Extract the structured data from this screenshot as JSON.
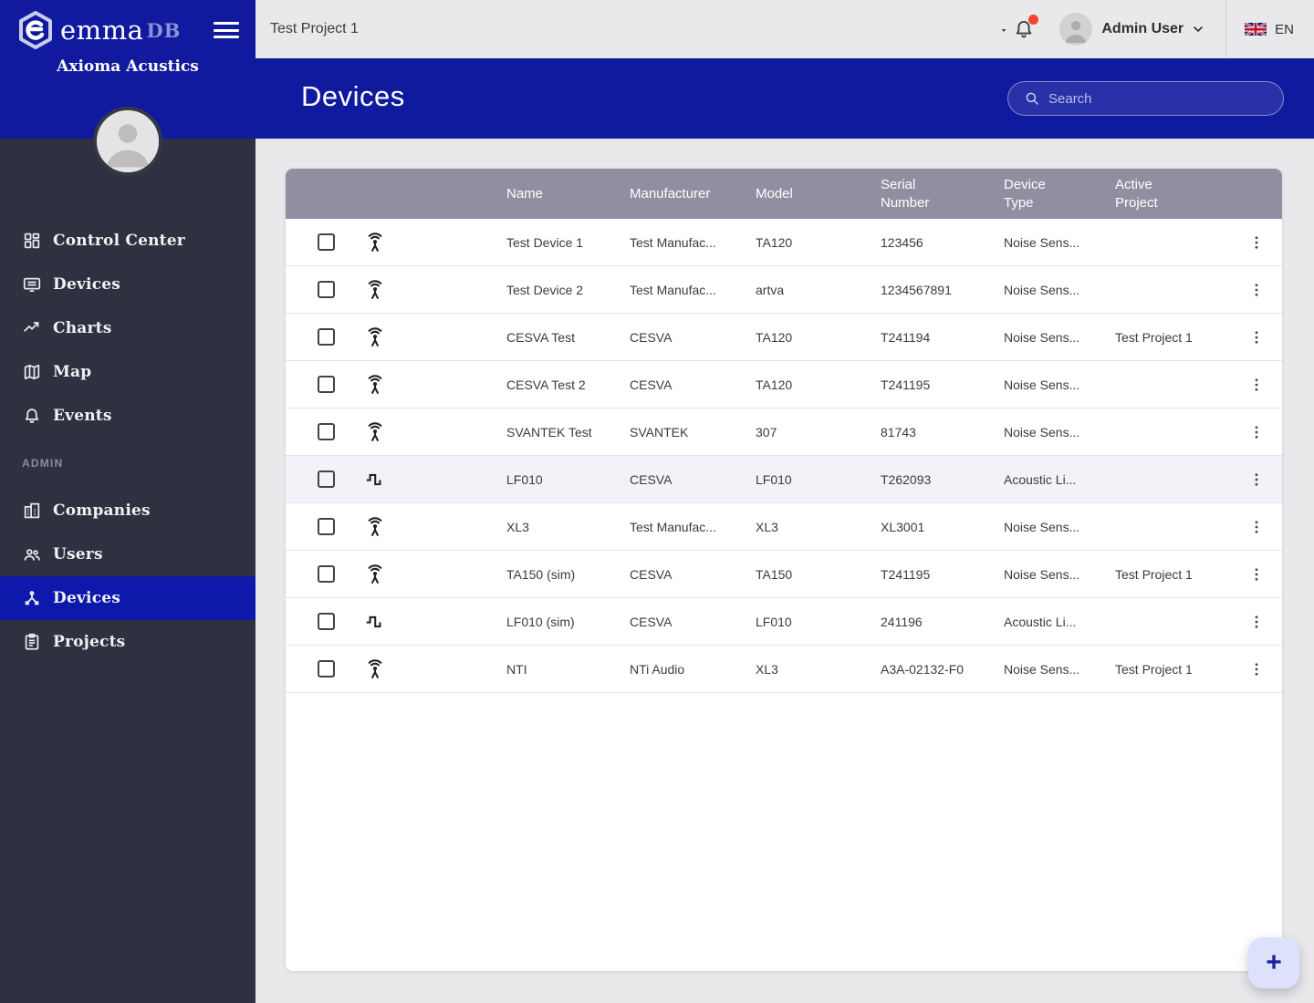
{
  "brand": {
    "logo_text": "emma",
    "logo_suffix": "DB",
    "company": "Axioma Acustics"
  },
  "topbar": {
    "project": "Test Project 1",
    "user_name": "Admin User",
    "language": "EN"
  },
  "page": {
    "title": "Devices",
    "search_placeholder": "Search"
  },
  "sidebar": {
    "admin_label": "ADMIN",
    "main_items": [
      {
        "id": "control-center",
        "label": "Control Center",
        "icon": "dashboard",
        "active": false
      },
      {
        "id": "devices",
        "label": "Devices",
        "icon": "screen",
        "active": false
      },
      {
        "id": "charts",
        "label": "Charts",
        "icon": "chart",
        "active": false
      },
      {
        "id": "map",
        "label": "Map",
        "icon": "map",
        "active": false
      },
      {
        "id": "events",
        "label": "Events",
        "icon": "bell",
        "active": false
      }
    ],
    "admin_items": [
      {
        "id": "companies",
        "label": "Companies",
        "icon": "building",
        "active": false
      },
      {
        "id": "users",
        "label": "Users",
        "icon": "users",
        "active": false
      },
      {
        "id": "admin-devices",
        "label": "Devices",
        "icon": "hub",
        "active": true
      },
      {
        "id": "projects",
        "label": "Projects",
        "icon": "clipboard",
        "active": false
      }
    ]
  },
  "table": {
    "columns": [
      "Name",
      "Manufacturer",
      "Model",
      "Serial Number",
      "Device Type",
      "Active Project"
    ],
    "rows": [
      {
        "name": "Test Device 1",
        "manufacturer": "Test Manufac...",
        "model": "TA120",
        "serial": "123456",
        "device_type": "Noise Sens...",
        "active_project": "",
        "icon": "noise-sensor",
        "highlighted": false
      },
      {
        "name": "Test Device 2",
        "manufacturer": "Test Manufac...",
        "model": "artva",
        "serial": "1234567891",
        "device_type": "Noise Sens...",
        "active_project": "",
        "icon": "noise-sensor",
        "highlighted": false
      },
      {
        "name": "CESVA Test",
        "manufacturer": "CESVA",
        "model": "TA120",
        "serial": "T241194",
        "device_type": "Noise Sens...",
        "active_project": "Test Project 1",
        "icon": "noise-sensor",
        "highlighted": false
      },
      {
        "name": "CESVA Test 2",
        "manufacturer": "CESVA",
        "model": "TA120",
        "serial": "T241195",
        "device_type": "Noise Sens...",
        "active_project": "",
        "icon": "noise-sensor",
        "highlighted": false
      },
      {
        "name": "SVANTEK Test",
        "manufacturer": "SVANTEK",
        "model": "307",
        "serial": "81743",
        "device_type": "Noise Sens...",
        "active_project": "",
        "icon": "noise-sensor",
        "highlighted": false
      },
      {
        "name": "LF010",
        "manufacturer": "CESVA",
        "model": "LF010",
        "serial": "T262093",
        "device_type": "Acoustic Li...",
        "active_project": "",
        "icon": "acoustic-limiter",
        "highlighted": true
      },
      {
        "name": "XL3",
        "manufacturer": "Test Manufac...",
        "model": "XL3",
        "serial": "XL3001",
        "device_type": "Noise Sens...",
        "active_project": "",
        "icon": "noise-sensor",
        "highlighted": false
      },
      {
        "name": "TA150 (sim)",
        "manufacturer": "CESVA",
        "model": "TA150",
        "serial": "T241195",
        "device_type": "Noise Sens...",
        "active_project": "Test Project 1",
        "icon": "noise-sensor",
        "highlighted": false
      },
      {
        "name": "LF010 (sim)",
        "manufacturer": "CESVA",
        "model": "LF010",
        "serial": "241196",
        "device_type": "Acoustic Li...",
        "active_project": "",
        "icon": "acoustic-limiter",
        "highlighted": false
      },
      {
        "name": "NTI",
        "manufacturer": "NTi Audio",
        "model": "XL3",
        "serial": "A3A-02132-F0",
        "device_type": "Noise Sens...",
        "active_project": "Test Project 1",
        "icon": "noise-sensor",
        "highlighted": false
      }
    ]
  },
  "fab": {
    "label": "+"
  }
}
